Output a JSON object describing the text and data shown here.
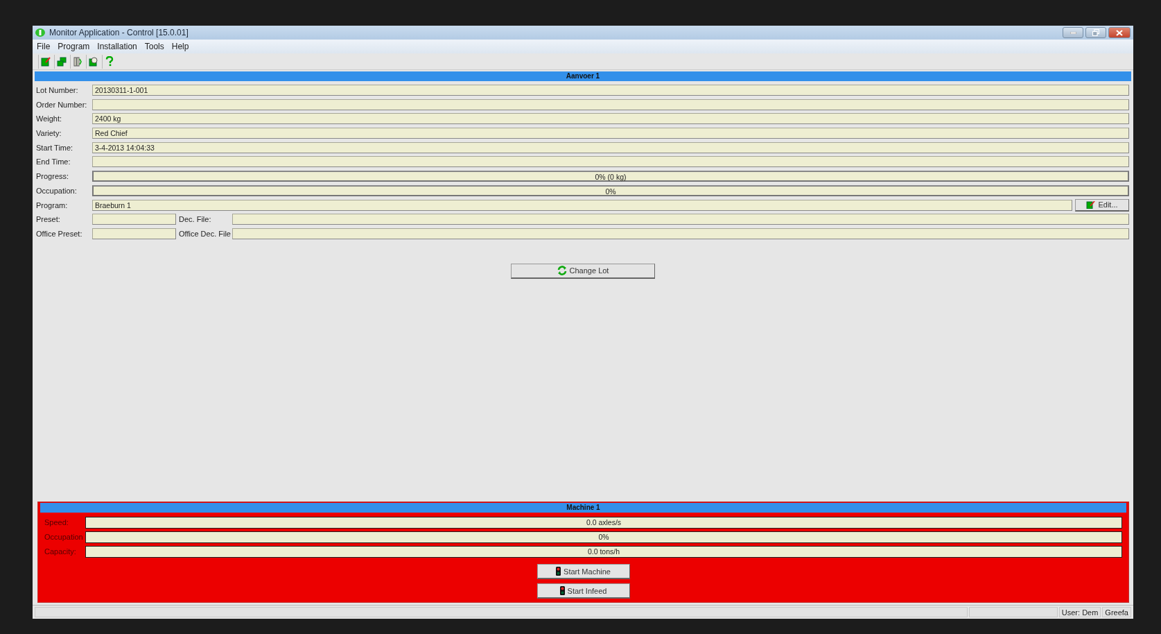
{
  "window": {
    "title": "Monitor Application - Control [15.0.01]"
  },
  "menu": [
    "File",
    "Program",
    "Installation",
    "Tools",
    "Help"
  ],
  "lot": {
    "title": "Aanvoer 1",
    "rows": [
      {
        "kind": "text",
        "label": "Lot Number:",
        "value": "20130311-1-001"
      },
      {
        "kind": "text",
        "label": "Order Number:"
      },
      {
        "kind": "text",
        "label": "Weight:",
        "value": "2400 kg"
      },
      {
        "kind": "text",
        "label": "Variety:",
        "value": "Red Chief"
      },
      {
        "kind": "text",
        "label": "Start Time:",
        "value": "3-4-2013 14:04:33"
      },
      {
        "kind": "text",
        "label": "End Time:"
      },
      {
        "kind": "bar",
        "label": "Progress:",
        "value": "0% (0 kg)",
        "level": 0
      },
      {
        "kind": "bar",
        "label": "Occupation:",
        "value": "0%",
        "level": 0
      },
      {
        "kind": "button",
        "label": "Program:",
        "value": "Braeburn 1",
        "button": "Edit..."
      },
      {
        "kind": "pair",
        "label": "Preset:",
        "label2": "Dec. File:"
      },
      {
        "kind": "pair",
        "label": "Office Preset:",
        "label2": "Office Dec. File"
      }
    ],
    "change_button": "Change Lot"
  },
  "machine": {
    "title": "Machine 1",
    "running": false,
    "rows": [
      {
        "label": "Speed:",
        "value": "0.0 axles/s"
      },
      {
        "label": "Occupation",
        "value": "0%"
      },
      {
        "label": "Capacity:",
        "value": "0.0 tons/h"
      }
    ],
    "buttons": [
      "Start Machine",
      "Start Infeed"
    ]
  },
  "status_bar": [
    "User: Dem",
    "Greefa"
  ]
}
